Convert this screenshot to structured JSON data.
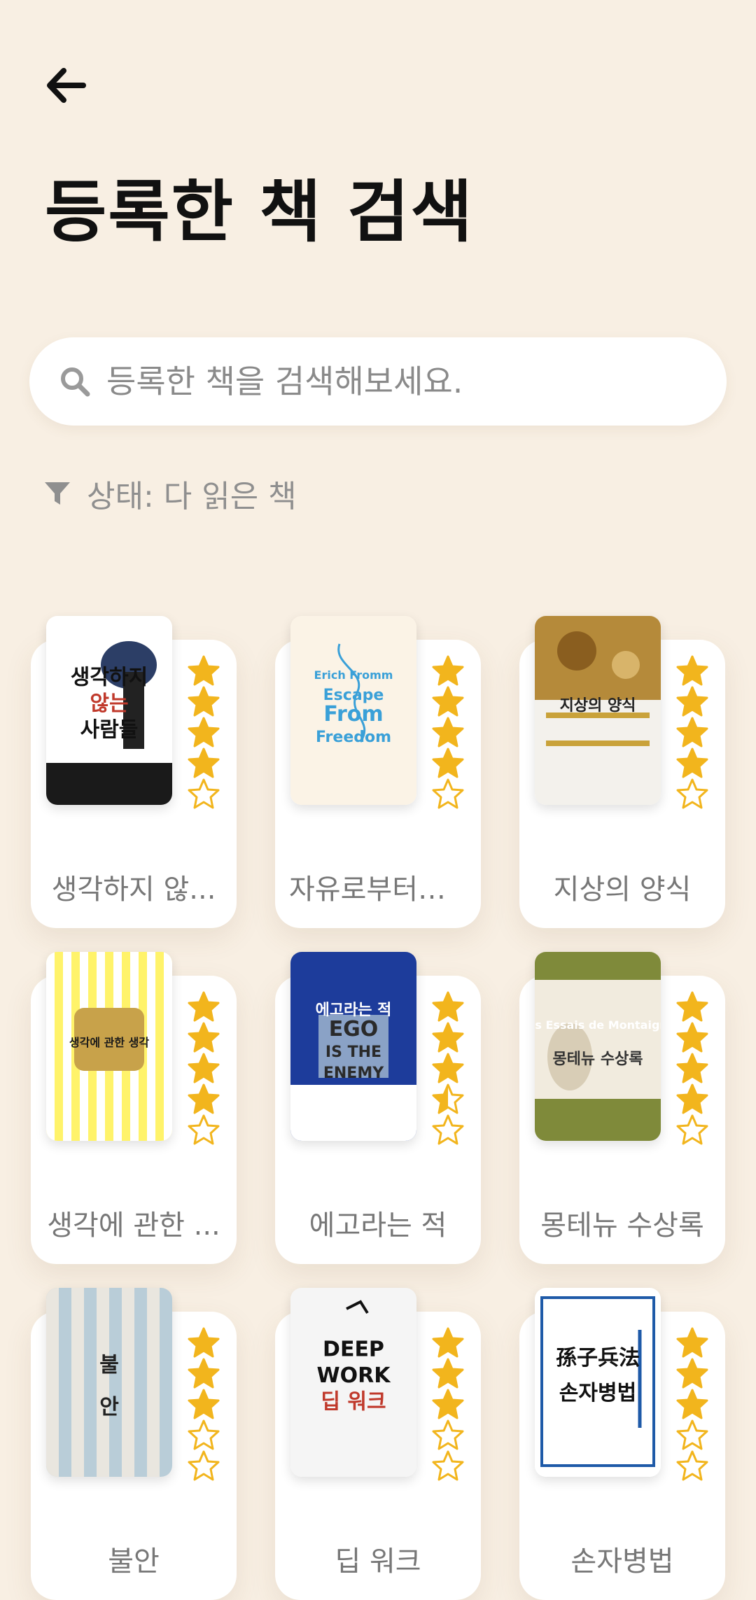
{
  "header": {
    "back_icon": "arrow-left-icon",
    "title": "등록한 책 검색"
  },
  "search": {
    "icon": "search-icon",
    "placeholder": "등록한 책을 검색해보세요.",
    "value": ""
  },
  "filter": {
    "icon": "filter-icon",
    "label": "상태: 다 읽은 책"
  },
  "colors": {
    "background": "#f8efe3",
    "star": "#f2b51d",
    "card": "#ffffff"
  },
  "books": [
    {
      "title": "생각하지 않...",
      "rating": 4,
      "cover": {
        "theme": "light",
        "bg": "#ffffff",
        "band": "#1a1a1a",
        "lines": [
          "생각하지",
          "않는",
          "사람들"
        ],
        "line_colors": [
          "#111111",
          "#c0392b",
          "#111111"
        ]
      }
    },
    {
      "title": "자유로부터의...",
      "rating": 4,
      "cover": {
        "theme": "light",
        "bg": "#fbf3e6",
        "band": "#fbf3e6",
        "lines": [
          "Erich Fromm",
          "Escape",
          "From",
          "Freedom"
        ],
        "line_colors": [
          "#3aa0d8",
          "#3aa0d8",
          "#3aa0d8",
          "#3aa0d8"
        ]
      }
    },
    {
      "title": "지상의 양식",
      "rating": 4,
      "cover": {
        "theme": "light",
        "bg": "#f3f1ec",
        "band": "#c9a23a",
        "lines": [
          "지상의 양식"
        ],
        "line_colors": [
          "#222222"
        ]
      }
    },
    {
      "title": "생각에 관한 ...",
      "rating": 4,
      "cover": {
        "theme": "light",
        "bg": "#fff36a",
        "band": "#ffffff",
        "lines": [
          "생각에 관한 생각"
        ],
        "line_colors": [
          "#1a1a1a"
        ]
      }
    },
    {
      "title": "에고라는 적",
      "rating": 3.5,
      "cover": {
        "theme": "dark",
        "bg": "#1d3c9b",
        "band": "#ffffff",
        "lines": [
          "에고라는 적",
          "EGO",
          "IS THE",
          "ENEMY"
        ],
        "line_colors": [
          "#ffffff",
          "#2a2a2a",
          "#2a2a2a",
          "#2a2a2a"
        ]
      }
    },
    {
      "title": "몽테뉴 수상록",
      "rating": 4,
      "cover": {
        "theme": "light",
        "bg": "#f1ebde",
        "band": "#7f8a3a",
        "lines": [
          "Les Essais de Montaigne",
          "몽테뉴 수상록"
        ],
        "line_colors": [
          "#ffffff",
          "#333333"
        ]
      }
    },
    {
      "title": "불안",
      "rating": 3,
      "cover": {
        "theme": "light",
        "bg": "#b9cdd8",
        "band": "#e9e6df",
        "lines": [
          "불",
          "안"
        ],
        "line_colors": [
          "#222222",
          "#222222"
        ]
      }
    },
    {
      "title": "딥 워크",
      "rating": 3,
      "cover": {
        "theme": "light",
        "bg": "#f5f5f5",
        "band": "#f5f5f5",
        "lines": [
          "DEEP",
          "WORK",
          "딥 워크"
        ],
        "line_colors": [
          "#111111",
          "#111111",
          "#c0392b"
        ]
      }
    },
    {
      "title": "손자병법",
      "rating": 3,
      "cover": {
        "theme": "light",
        "bg": "#ffffff",
        "band": "#1e5aa8",
        "lines": [
          "孫子兵法",
          "손자병법"
        ],
        "line_colors": [
          "#111111",
          "#111111"
        ]
      }
    }
  ]
}
